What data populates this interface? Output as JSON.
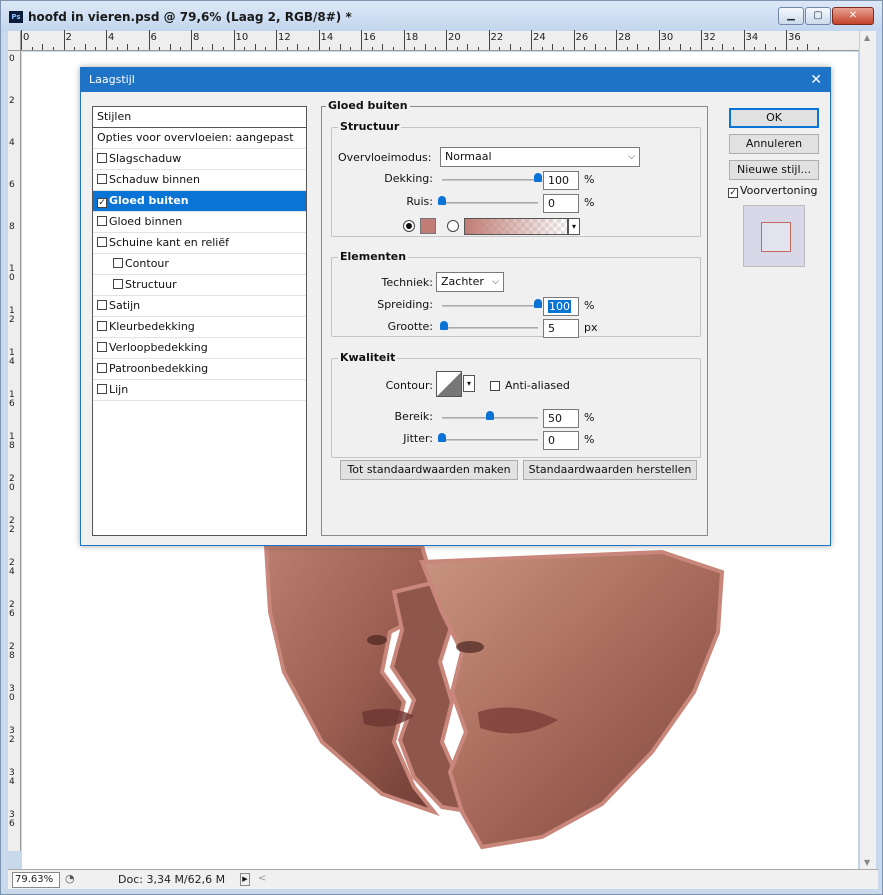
{
  "window": {
    "title": "hoofd in vieren.psd @ 79,6% (Laag 2, RGB/8#) *",
    "app_icon": "Ps",
    "controls": [
      "minimize",
      "maximize",
      "close"
    ]
  },
  "rulers": {
    "top_labels": [
      "0",
      "2",
      "4",
      "6",
      "8",
      "10",
      "12",
      "14",
      "16",
      "18",
      "20",
      "22",
      "24",
      "26",
      "28",
      "30",
      "32",
      "34",
      "36"
    ],
    "left_labels": [
      "0",
      "2",
      "4",
      "6",
      "8",
      "10",
      "12",
      "14",
      "16",
      "18",
      "20",
      "22",
      "24",
      "26",
      "28",
      "30",
      "32",
      "34",
      "36"
    ]
  },
  "status": {
    "zoom": "79.63%",
    "doc": "Doc: 3,34 M/62,6 M"
  },
  "dialog": {
    "title": "Laagstijl",
    "styles_header": "Stijlen",
    "blend_options": "Opties voor overvloeien: aangepast",
    "styles": [
      {
        "label": "Slagschaduw",
        "checked": false,
        "indent": false
      },
      {
        "label": "Schaduw binnen",
        "checked": false,
        "indent": false
      },
      {
        "label": "Gloed buiten",
        "checked": true,
        "indent": false,
        "selected": true
      },
      {
        "label": "Gloed binnen",
        "checked": false,
        "indent": false
      },
      {
        "label": "Schuine kant en reliëf",
        "checked": false,
        "indent": false
      },
      {
        "label": "Contour",
        "checked": false,
        "indent": true
      },
      {
        "label": "Structuur",
        "checked": false,
        "indent": true
      },
      {
        "label": "Satijn",
        "checked": false,
        "indent": false
      },
      {
        "label": "Kleurbedekking",
        "checked": false,
        "indent": false
      },
      {
        "label": "Verloopbedekking",
        "checked": false,
        "indent": false
      },
      {
        "label": "Patroonbedekking",
        "checked": false,
        "indent": false
      },
      {
        "label": "Lijn",
        "checked": false,
        "indent": false
      }
    ],
    "panel": {
      "title": "Gloed buiten",
      "structure": {
        "title": "Structuur",
        "blend_mode_label": "Overvloeimodus:",
        "blend_mode_value": "Normaal",
        "opacity_label": "Dekking:",
        "opacity_value": "100",
        "opacity_unit": "%",
        "opacity_level": 1.0,
        "noise_label": "Ruis:",
        "noise_value": "0",
        "noise_unit": "%",
        "noise_level": 0.0,
        "glow_color": "#c17d75"
      },
      "elements": {
        "title": "Elementen",
        "technique_label": "Techniek:",
        "technique_value": "Zachter",
        "spread_label": "Spreiding:",
        "spread_value": "100",
        "spread_unit": "%",
        "spread_level": 1.0,
        "size_label": "Grootte:",
        "size_value": "5",
        "size_unit": "px",
        "size_level": 0.02
      },
      "quality": {
        "title": "Kwaliteit",
        "contour_label": "Contour:",
        "antialias_label": "Anti-aliased",
        "antialias_checked": false,
        "range_label": "Bereik:",
        "range_value": "50",
        "range_unit": "%",
        "range_level": 0.5,
        "jitter_label": "Jitter:",
        "jitter_value": "0",
        "jitter_unit": "%",
        "jitter_level": 0.0
      },
      "make_default": "Tot standaardwaarden maken",
      "reset_default": "Standaardwaarden herstellen"
    },
    "buttons": {
      "ok": "OK",
      "cancel": "Annuleren",
      "new_style": "Nieuwe stijl...",
      "preview_label": "Voorvertoning",
      "preview_checked": true
    }
  },
  "colors": {
    "accent": "#0a73d6",
    "dialog_title_bar": "#1e73c6",
    "glow": "#c17d75"
  }
}
